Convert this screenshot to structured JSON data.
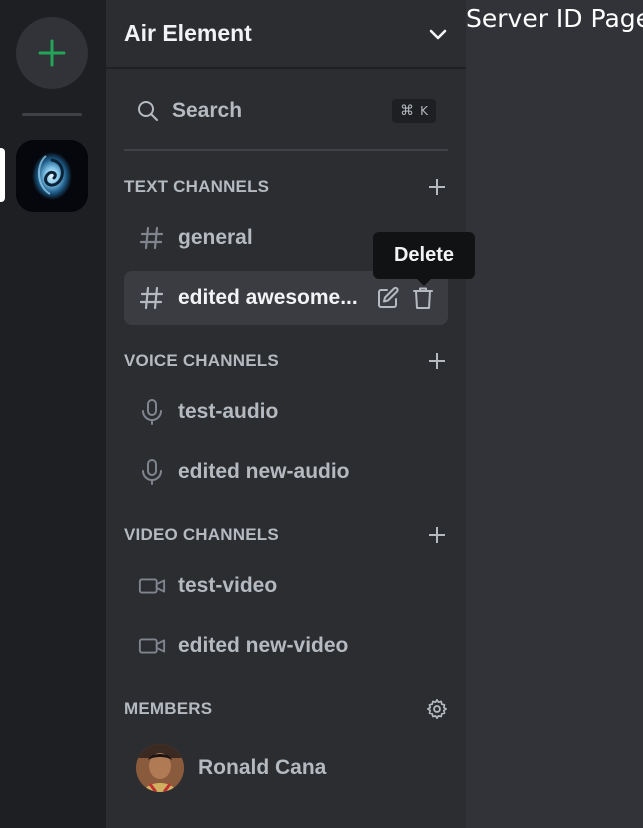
{
  "server": {
    "name": "Air Element"
  },
  "search": {
    "label": "Search",
    "shortcut_symbol": "⌘",
    "shortcut_key": "K"
  },
  "sections": {
    "text": {
      "title": "TEXT CHANNELS"
    },
    "voice": {
      "title": "VOICE CHANNELS"
    },
    "video": {
      "title": "VIDEO CHANNELS"
    },
    "members": {
      "title": "MEMBERS"
    }
  },
  "text_channels": [
    {
      "label": "general"
    },
    {
      "label": "edited awesome...",
      "active": true
    }
  ],
  "voice_channels": [
    {
      "label": "test-audio"
    },
    {
      "label": "edited new-audio"
    }
  ],
  "video_channels": [
    {
      "label": "test-video"
    },
    {
      "label": "edited new-video"
    }
  ],
  "tooltip": {
    "text": "Delete"
  },
  "members": [
    {
      "name": "Ronald Cana"
    }
  ],
  "page": {
    "text": "Server ID Page"
  },
  "colors": {
    "accent_green": "#23a559",
    "rail_bg": "#1e1f22",
    "sidebar_bg": "#2b2d31",
    "main_bg": "#313338"
  },
  "icons": {
    "add_server": "plus-icon",
    "server_menu": "chevron-down-icon",
    "search": "search-icon",
    "text_channel": "hash-icon",
    "voice_channel": "microphone-icon",
    "video_channel": "video-camera-icon",
    "edit": "edit-icon",
    "delete": "trash-icon",
    "settings": "gear-icon"
  }
}
